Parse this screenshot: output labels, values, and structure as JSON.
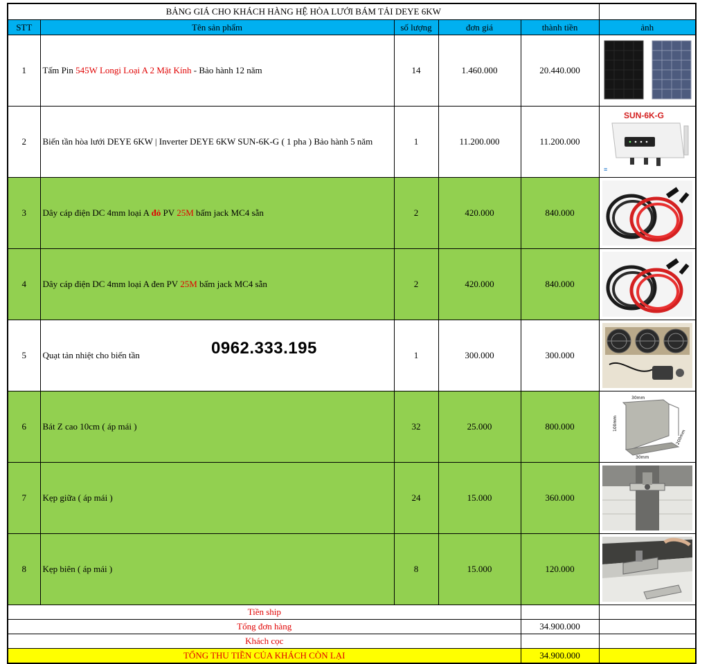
{
  "title": "BẢNG GIÁ CHO KHÁCH HÀNG HỆ HÒA LƯỚI BÁM TẢI DEYE 6KW",
  "headers": {
    "stt": "STT",
    "name": "Tên sản phẩm",
    "qty": "số lượng",
    "price": "đơn giá",
    "total": "thành tiền",
    "image": "ảnh"
  },
  "items": [
    {
      "stt": "1",
      "name_a": "Tấm Pin ",
      "name_b": "545W Longi Loại A 2 Mặt Kính",
      "name_c": " - Bảo hành 12 năm",
      "qty": "14",
      "price": "1.460.000",
      "total": "20.440.000",
      "image_icon": "solar-panel-icon"
    },
    {
      "stt": "2",
      "name": "Biến tần hòa lưới DEYE 6KW | Inverter DEYE 6KW SUN-6K-G ( 1 pha )  Bảo hành 5 năm",
      "qty": "1",
      "price": "11.200.000",
      "total": "11.200.000",
      "image_icon": "inverter-icon",
      "image_label": "SUN-6K-G"
    },
    {
      "stt": "3",
      "name_a": "Dây cáp điện DC 4mm loại A ",
      "name_b": "đỏ",
      "name_c": " PV ",
      "name_d": "25M",
      "name_e": " bấm jack MC4 sẵn",
      "qty": "2",
      "price": "420.000",
      "total": "840.000",
      "image_icon": "cable-coil-icon"
    },
    {
      "stt": "4",
      "name_a": "Dây cáp điện DC 4mm loại A đen PV ",
      "name_b": "25M",
      "name_c": " bấm jack MC4 sẵn",
      "qty": "2",
      "price": "420.000",
      "total": "840.000",
      "image_icon": "cable-coil-icon"
    },
    {
      "stt": "5",
      "name": "Quạt tản nhiệt cho biến tần",
      "qty": "1",
      "price": "300.000",
      "total": "300.000",
      "image_icon": "cooling-fan-icon"
    },
    {
      "stt": "6",
      "name": "Bát Z cao 10cm ( áp mái )",
      "qty": "32",
      "price": "25.000",
      "total": "800.000",
      "image_icon": "z-bracket-icon",
      "image_dims": [
        "30mm",
        "100mm",
        "200mm",
        "30mm"
      ]
    },
    {
      "stt": "7",
      "name": "Kẹp giữa ( áp mái )",
      "qty": "24",
      "price": "15.000",
      "total": "360.000",
      "image_icon": "mid-clamp-icon"
    },
    {
      "stt": "8",
      "name": "Kẹp biên ( áp mái )",
      "qty": "8",
      "price": "15.000",
      "total": "120.000",
      "image_icon": "end-clamp-icon"
    }
  ],
  "phone": "0962.333.195",
  "summary": {
    "shipping_label": "Tiền ship",
    "shipping_value": "",
    "order_total_label": "Tổng đơn hàng",
    "order_total_value": "34.900.000",
    "deposit_label": "Khách cọc",
    "deposit_value": "",
    "grand_total_label": "TỔNG THU TIỀN CỦA KHÁCH CÒN LẠI",
    "grand_total_value": "34.900.000"
  },
  "colors": {
    "header_bg": "#00b0f0",
    "green_row": "#92d050",
    "final_row": "#ffff00",
    "accent_red": "#e00000"
  }
}
